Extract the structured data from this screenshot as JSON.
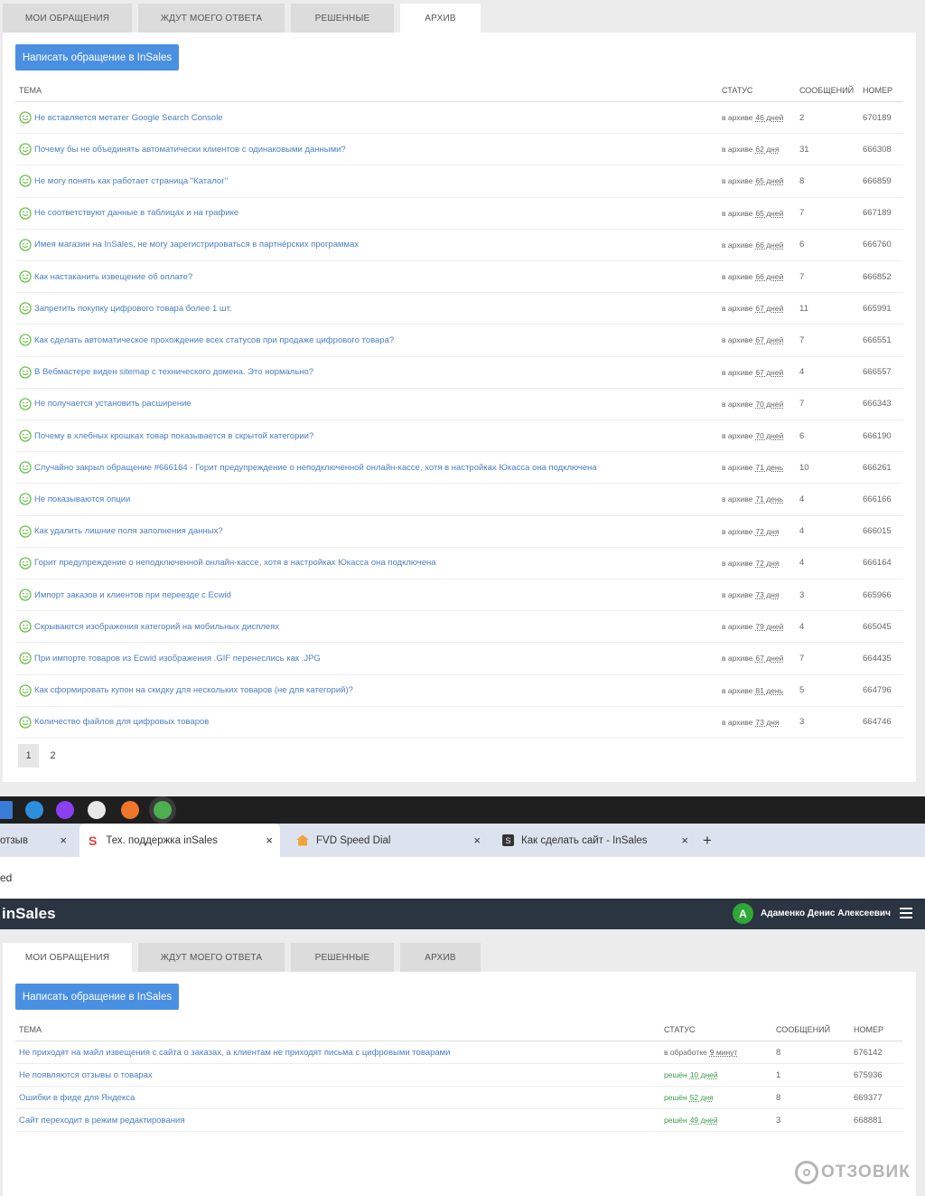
{
  "tabs": {
    "my": "МОИ ОБРАЩЕНИЯ",
    "waiting": "ЖДУТ МОЕГО ОТВЕТА",
    "solved": "РЕШЕННЫЕ",
    "archive": "АРХИВ"
  },
  "new_button": "Написать обращение в InSales",
  "columns": {
    "subject": "ТЕМА",
    "status": "СТАТУС",
    "messages": "СООБЩЕНИЙ",
    "number": "НОМЕР"
  },
  "archive_rows": [
    {
      "subject": "Не вставляется метатег Google Search Console",
      "status": "в архиве",
      "duration": "46 дней",
      "messages": "2",
      "number": "670189"
    },
    {
      "subject": "Почему бы не объединять автоматически клиентов с одинаковыми данными?",
      "status": "в архиве",
      "duration": "62 дня",
      "messages": "31",
      "number": "666308"
    },
    {
      "subject": "Не могу понять как работает страница \"Каталог\"",
      "status": "в архиве",
      "duration": "65 дней",
      "messages": "8",
      "number": "666859"
    },
    {
      "subject": "Не соответствуют данные в таблицах и на графике",
      "status": "в архиве",
      "duration": "65 дней",
      "messages": "7",
      "number": "667189"
    },
    {
      "subject": "Имея магазин на InSales, не могу зарегистрироваться в партнёрских программах",
      "status": "в архиве",
      "duration": "66 дней",
      "messages": "6",
      "number": "666760"
    },
    {
      "subject": "Как настаканить извещение об оплате?",
      "status": "в архиве",
      "duration": "66 дней",
      "messages": "7",
      "number": "666852"
    },
    {
      "subject": "Запретить покупку цифрового товара более 1 шт.",
      "status": "в архиве",
      "duration": "67 дней",
      "messages": "11",
      "number": "665991"
    },
    {
      "subject": "Как сделать автоматическое прохождение всех статусов при продаже цифрового товара?",
      "status": "в архиве",
      "duration": "67 дней",
      "messages": "7",
      "number": "666551"
    },
    {
      "subject": "В Вебмастере виден sitemap с технического домена. Это нормально?",
      "status": "в архиве",
      "duration": "67 дней",
      "messages": "4",
      "number": "666557"
    },
    {
      "subject": "Не получается установить расширение",
      "status": "в архиве",
      "duration": "70 дней",
      "messages": "7",
      "number": "666343"
    },
    {
      "subject": "Почему в хлебных крошках товар показывается в скрытой категории?",
      "status": "в архиве",
      "duration": "70 дней",
      "messages": "6",
      "number": "666190"
    },
    {
      "subject": "Случайно закрыл обращение #666164 - Горит предупреждение о неподключенной онлайн-кассе, хотя в настройках Юкасса она подключена",
      "status": "в архиве",
      "duration": "71 день",
      "messages": "10",
      "number": "666261"
    },
    {
      "subject": "Не показываются опции",
      "status": "в архиве",
      "duration": "71 день",
      "messages": "4",
      "number": "666166"
    },
    {
      "subject": "Как удалить лишние поля заполнения данных?",
      "status": "в архиве",
      "duration": "72 дня",
      "messages": "4",
      "number": "666015"
    },
    {
      "subject": "Горит предупреждение о неподключенной онлайн-кассе, хотя в настройках Юкасса она подключена",
      "status": "в архиве",
      "duration": "72 дня",
      "messages": "4",
      "number": "666164"
    },
    {
      "subject": "Импорт заказов и клиентов при переезде с Ecwid",
      "status": "в архиве",
      "duration": "73 дня",
      "messages": "3",
      "number": "665966"
    },
    {
      "subject": "Скрываются изображения категорий на мобильных дисплеях",
      "status": "в архиве",
      "duration": "79 дней",
      "messages": "4",
      "number": "665045"
    },
    {
      "subject": "При импорте товаров из Ecwid изображения .GIF перенеслись как .JPG",
      "status": "в архиве",
      "duration": "67 дней",
      "messages": "7",
      "number": "664435"
    },
    {
      "subject": "Как сформировать купон на скидку для нескольких товаров (не для категорий)?",
      "status": "в архиве",
      "duration": "81 день",
      "messages": "5",
      "number": "664796"
    },
    {
      "subject": "Количество файлов для цифровых товаров",
      "status": "в архиве",
      "duration": "73 дня",
      "messages": "3",
      "number": "664746"
    }
  ],
  "pagination": [
    "1",
    "2"
  ],
  "browser_tabs": [
    {
      "title": "отзыв"
    },
    {
      "title": "Тех. поддержка inSales"
    },
    {
      "title": "FVD Speed Dial"
    },
    {
      "title": "Как сделать сайт - InSales"
    }
  ],
  "tab_close": "×",
  "new_tab": "+",
  "address_fragment": "ed",
  "app": {
    "logo": "inSales",
    "avatar_letter": "А",
    "user_name": "Адаменко Денис Алексеевич"
  },
  "my_rows": [
    {
      "subject": "Не приходят на майл извещения с сайта о заказах, а клиентам не приходят письма с цифровыми товарами",
      "status": "в обработке",
      "duration": "9 минут",
      "messages": "8",
      "number": "676142"
    },
    {
      "subject": "Не появляются отзывы о товарах",
      "status": "решён",
      "duration": "10 дней",
      "messages": "1",
      "number": "675936"
    },
    {
      "subject": "Ошибки в фиде для Яндекса",
      "status": "решён",
      "duration": "52 дня",
      "messages": "8",
      "number": "669377"
    },
    {
      "subject": "Сайт переходит в режим редактирования",
      "status": "решён",
      "duration": "49 дней",
      "messages": "3",
      "number": "668881"
    }
  ],
  "watermark": "ОТЗОВИК",
  "colors": {
    "accent": "#4a90e2",
    "link": "#4a7fc1",
    "solved": "#3b9b4b",
    "header_bg": "#2b3441",
    "smile": "#6cc04a"
  }
}
